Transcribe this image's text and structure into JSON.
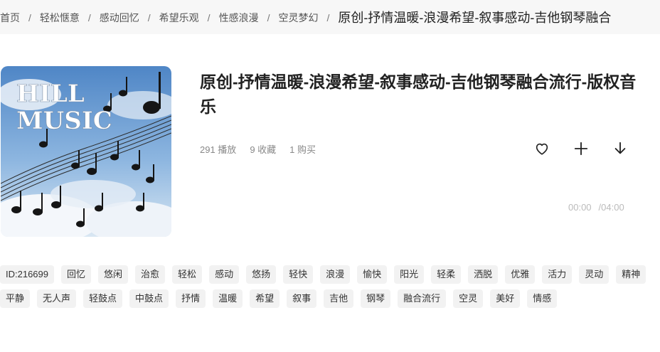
{
  "breadcrumb": {
    "items": [
      "首页",
      "轻松惬意",
      "感动回忆",
      "希望乐观",
      "性感浪漫",
      "空灵梦幻"
    ],
    "separator": "/",
    "current": "原创-抒情温暖-浪漫希望-叙事感动-吉他钢琴融合"
  },
  "cover": {
    "logo_line1": "HILL",
    "logo_line2": "MUSIC"
  },
  "track": {
    "title": "原创-抒情温暖-浪漫希望-叙事感动-吉他钢琴融合流行-版权音乐",
    "plays": "291 播放",
    "favorites": "9 收藏",
    "purchases": "1 购买"
  },
  "actions": [
    {
      "icon": "heart-icon"
    },
    {
      "icon": "plus-icon"
    },
    {
      "icon": "download-icon"
    }
  ],
  "player": {
    "current_time": "00:00",
    "duration": "/04:00"
  },
  "tags": [
    "ID:216699",
    "回忆",
    "悠闲",
    "治愈",
    "轻松",
    "感动",
    "悠扬",
    "轻快",
    "浪漫",
    "愉快",
    "阳光",
    "轻柔",
    "洒脱",
    "优雅",
    "活力",
    "灵动",
    "精神",
    "平静",
    "无人声",
    "轻鼓点",
    "中鼓点",
    "抒情",
    "温暖",
    "希望",
    "叙事",
    "吉他",
    "钢琴",
    "融合流行",
    "空灵",
    "美好",
    "情感"
  ]
}
